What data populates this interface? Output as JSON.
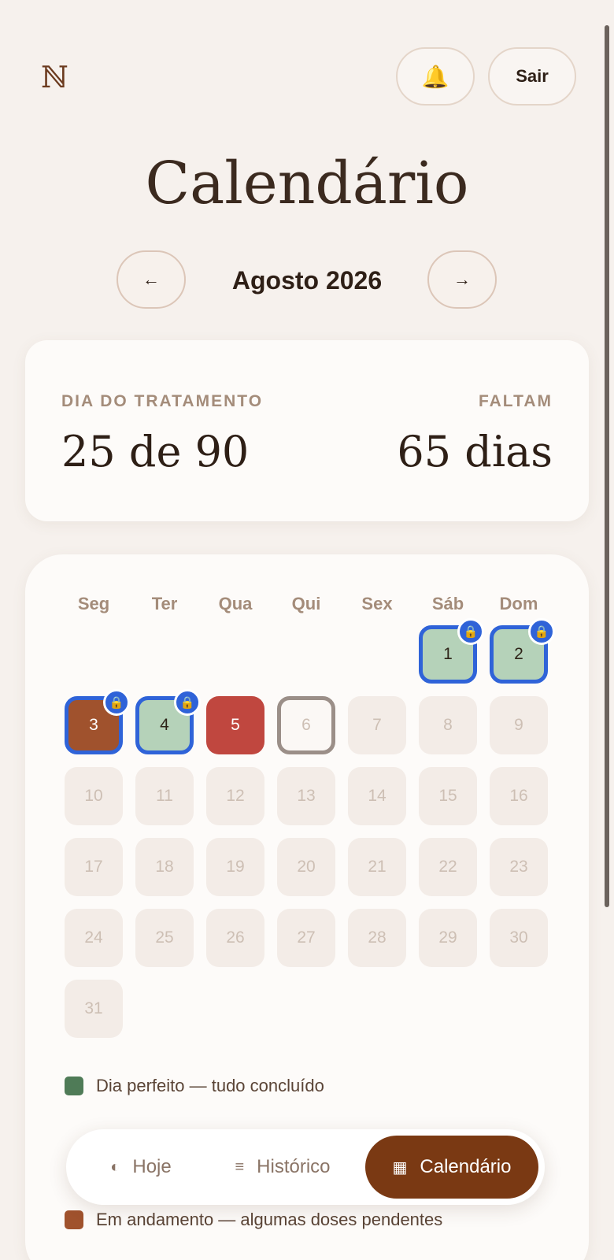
{
  "header": {
    "logo_text": "ℕ",
    "bell_icon": "bell-icon",
    "sair_label": "Sair"
  },
  "page_title": "Calendário",
  "month_nav": {
    "prev_icon": "←",
    "next_icon": "→",
    "month_label": "Agosto 2026"
  },
  "stats": {
    "day_label": "DIA DO TRATAMENTO",
    "day_value": "25 de 90",
    "remaining_label": "FALTAM",
    "remaining_value": "65 dias"
  },
  "calendar": {
    "weekdays": [
      "Seg",
      "Ter",
      "Qua",
      "Qui",
      "Sex",
      "Sáb",
      "Dom"
    ],
    "first_weekday_index": 5,
    "days": [
      {
        "n": "1",
        "status": "green",
        "locked": true
      },
      {
        "n": "2",
        "status": "green",
        "locked": true
      },
      {
        "n": "3",
        "status": "brown",
        "locked": true
      },
      {
        "n": "4",
        "status": "green",
        "locked": true
      },
      {
        "n": "5",
        "status": "red",
        "locked": false
      },
      {
        "n": "6",
        "status": "today",
        "locked": false
      },
      {
        "n": "7",
        "status": "future",
        "locked": false
      },
      {
        "n": "8",
        "status": "future",
        "locked": false
      },
      {
        "n": "9",
        "status": "future",
        "locked": false
      },
      {
        "n": "10",
        "status": "future",
        "locked": false
      },
      {
        "n": "11",
        "status": "future",
        "locked": false
      },
      {
        "n": "12",
        "status": "future",
        "locked": false
      },
      {
        "n": "13",
        "status": "future",
        "locked": false
      },
      {
        "n": "14",
        "status": "future",
        "locked": false
      },
      {
        "n": "15",
        "status": "future",
        "locked": false
      },
      {
        "n": "16",
        "status": "future",
        "locked": false
      },
      {
        "n": "17",
        "status": "future",
        "locked": false
      },
      {
        "n": "18",
        "status": "future",
        "locked": false
      },
      {
        "n": "19",
        "status": "future",
        "locked": false
      },
      {
        "n": "20",
        "status": "future",
        "locked": false
      },
      {
        "n": "21",
        "status": "future",
        "locked": false
      },
      {
        "n": "22",
        "status": "future",
        "locked": false
      },
      {
        "n": "23",
        "status": "future",
        "locked": false
      },
      {
        "n": "24",
        "status": "future",
        "locked": false
      },
      {
        "n": "25",
        "status": "future",
        "locked": false
      },
      {
        "n": "26",
        "status": "future",
        "locked": false
      },
      {
        "n": "27",
        "status": "future",
        "locked": false
      },
      {
        "n": "28",
        "status": "future",
        "locked": false
      },
      {
        "n": "29",
        "status": "future",
        "locked": false
      },
      {
        "n": "30",
        "status": "future",
        "locked": false
      },
      {
        "n": "31",
        "status": "future",
        "locked": false
      }
    ],
    "lock_icon": "🔒"
  },
  "legend": [
    {
      "color": "#4f7b57",
      "label": "Dia perfeito — tudo concluído"
    },
    {
      "color": "#a0522d",
      "label": "Em andamento — algumas doses pendentes"
    }
  ],
  "bottom_nav": {
    "hoje_icon": "◐",
    "hoje_label": "Hoje",
    "historico_icon": "≡",
    "historico_label": "Histórico",
    "calendario_icon": "▦",
    "calendario_label": "Calendário"
  }
}
